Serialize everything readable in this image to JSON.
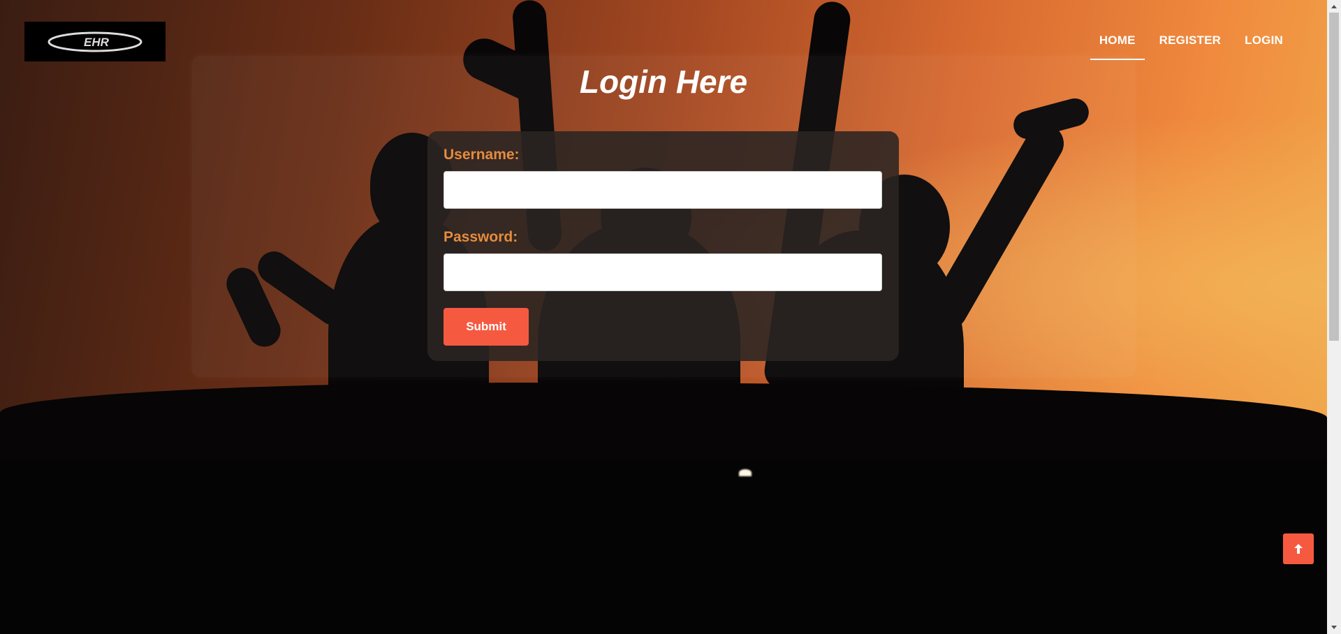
{
  "header": {
    "logo_text": "EHR",
    "nav": [
      {
        "label": "HOME",
        "active": true
      },
      {
        "label": "REGISTER",
        "active": false
      },
      {
        "label": "LOGIN",
        "active": false
      }
    ]
  },
  "main": {
    "title": "Login Here",
    "username_label": "Username:",
    "username_value": "",
    "password_label": "Password:",
    "password_value": "",
    "submit_label": "Submit"
  },
  "colors": {
    "accent": "#f55a41",
    "label": "#e58c3f",
    "form_bg": "#2a2422"
  },
  "icons": {
    "scroll_top": "arrow-up-icon"
  }
}
